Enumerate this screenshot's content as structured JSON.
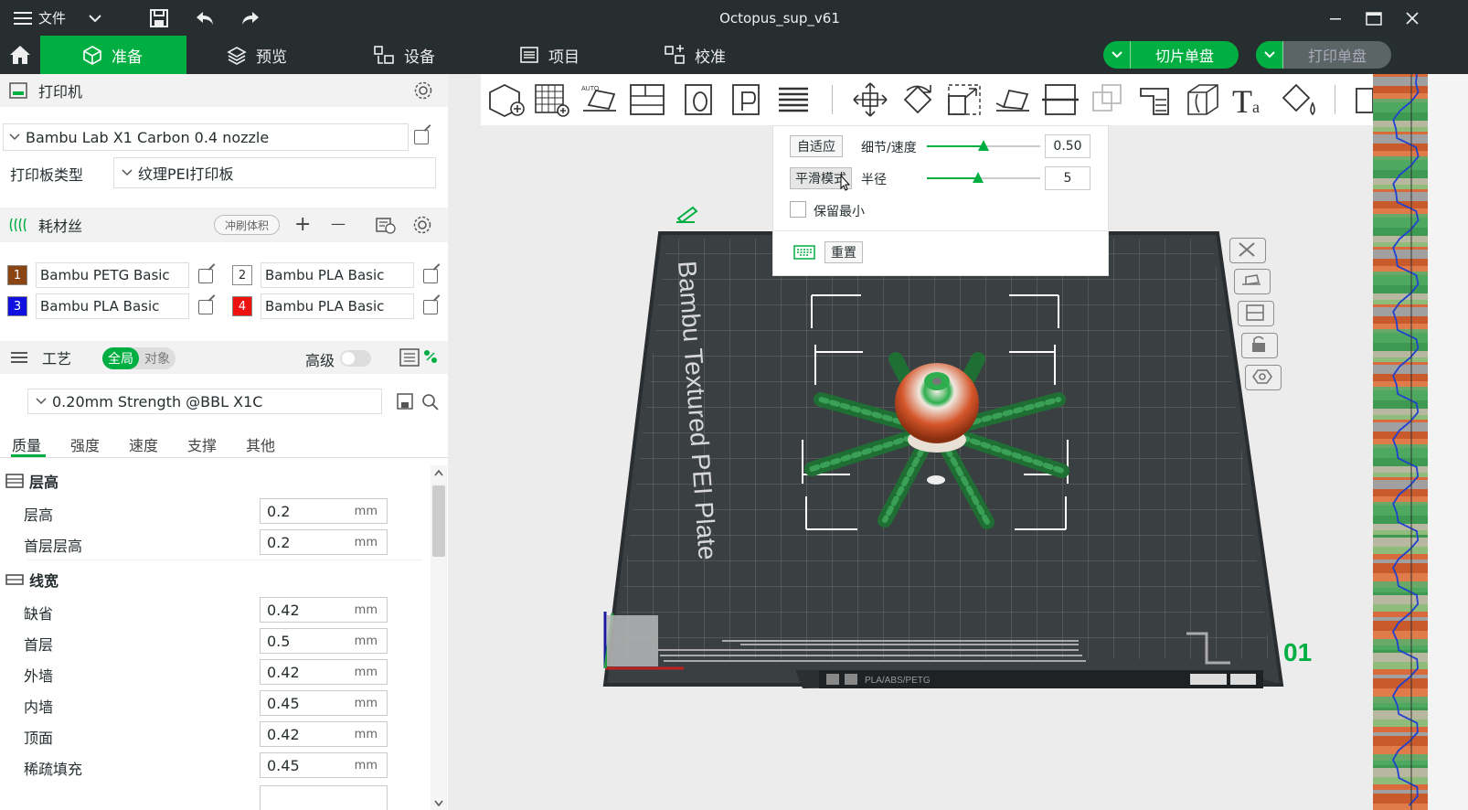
{
  "titlebar": {
    "menu_label": "文件",
    "title": "Octopus_sup_v61",
    "icons": [
      "menu-icon",
      "chevron-down-icon",
      "save-icon",
      "undo-icon",
      "redo-icon",
      "minimize-icon",
      "maximize-icon",
      "close-icon"
    ]
  },
  "tabs": [
    {
      "label": "准备",
      "icon": "cube-icon",
      "active": true
    },
    {
      "label": "预览",
      "icon": "layers-icon",
      "active": false
    },
    {
      "label": "设备",
      "icon": "device-icon",
      "active": false
    },
    {
      "label": "项目",
      "icon": "list-icon",
      "active": false
    },
    {
      "label": "校准",
      "icon": "calibrate-icon",
      "active": false
    }
  ],
  "actions": {
    "slice_label": "切片单盘",
    "print_label": "打印单盘"
  },
  "printer": {
    "section_title": "打印机",
    "model": "Bambu Lab X1 Carbon 0.4 nozzle",
    "plate_type_label": "打印板类型",
    "plate_type": "纹理PEI打印板"
  },
  "filament": {
    "section_title": "耗材丝",
    "flush_label": "冲刷体积",
    "plus_label": "+",
    "minus_label": "—",
    "items": [
      {
        "num": "1",
        "color": "#8b4513",
        "name": "Bambu PETG Basic"
      },
      {
        "num": "2",
        "color": "#ffffff",
        "name": "Bambu PLA Basic"
      },
      {
        "num": "3",
        "color": "#1010e0",
        "name": "Bambu PLA Basic"
      },
      {
        "num": "4",
        "color": "#ee1111",
        "name": "Bambu PLA Basic"
      }
    ]
  },
  "process": {
    "section_title": "工艺",
    "toggle_global": "全局",
    "toggle_object": "对象",
    "advanced_label": "高级",
    "preset": "0.20mm Strength @BBL X1C",
    "subtabs": [
      "质量",
      "强度",
      "速度",
      "支撑",
      "其他"
    ],
    "groups": [
      {
        "title": "层高",
        "params": [
          {
            "label": "层高",
            "value": "0.2",
            "unit": "mm"
          },
          {
            "label": "首层层高",
            "value": "0.2",
            "unit": "mm"
          }
        ]
      },
      {
        "title": "线宽",
        "params": [
          {
            "label": "缺省",
            "value": "0.42",
            "unit": "mm"
          },
          {
            "label": "首层",
            "value": "0.5",
            "unit": "mm"
          },
          {
            "label": "外墙",
            "value": "0.42",
            "unit": "mm"
          },
          {
            "label": "内墙",
            "value": "0.45",
            "unit": "mm"
          },
          {
            "label": "顶面",
            "value": "0.42",
            "unit": "mm"
          },
          {
            "label": "稀疏填充",
            "value": "0.45",
            "unit": "mm"
          }
        ]
      }
    ]
  },
  "popup": {
    "adaptive_label": "自适应",
    "detail_speed_label": "细节/速度",
    "detail_value": "0.50",
    "detail_fraction": 0.5,
    "smooth_label": "平滑模式",
    "radius_label": "半径",
    "radius_value": "5",
    "radius_fraction": 0.45,
    "keep_min_label": "保留最小",
    "reset_label": "重置"
  },
  "plate": {
    "label": "Bambu Textured PEI Plate",
    "number": "01",
    "footer_text": "PLA/ABS/PETG"
  },
  "colors": {
    "accent": "#00ae42",
    "dark": "#262e30"
  }
}
